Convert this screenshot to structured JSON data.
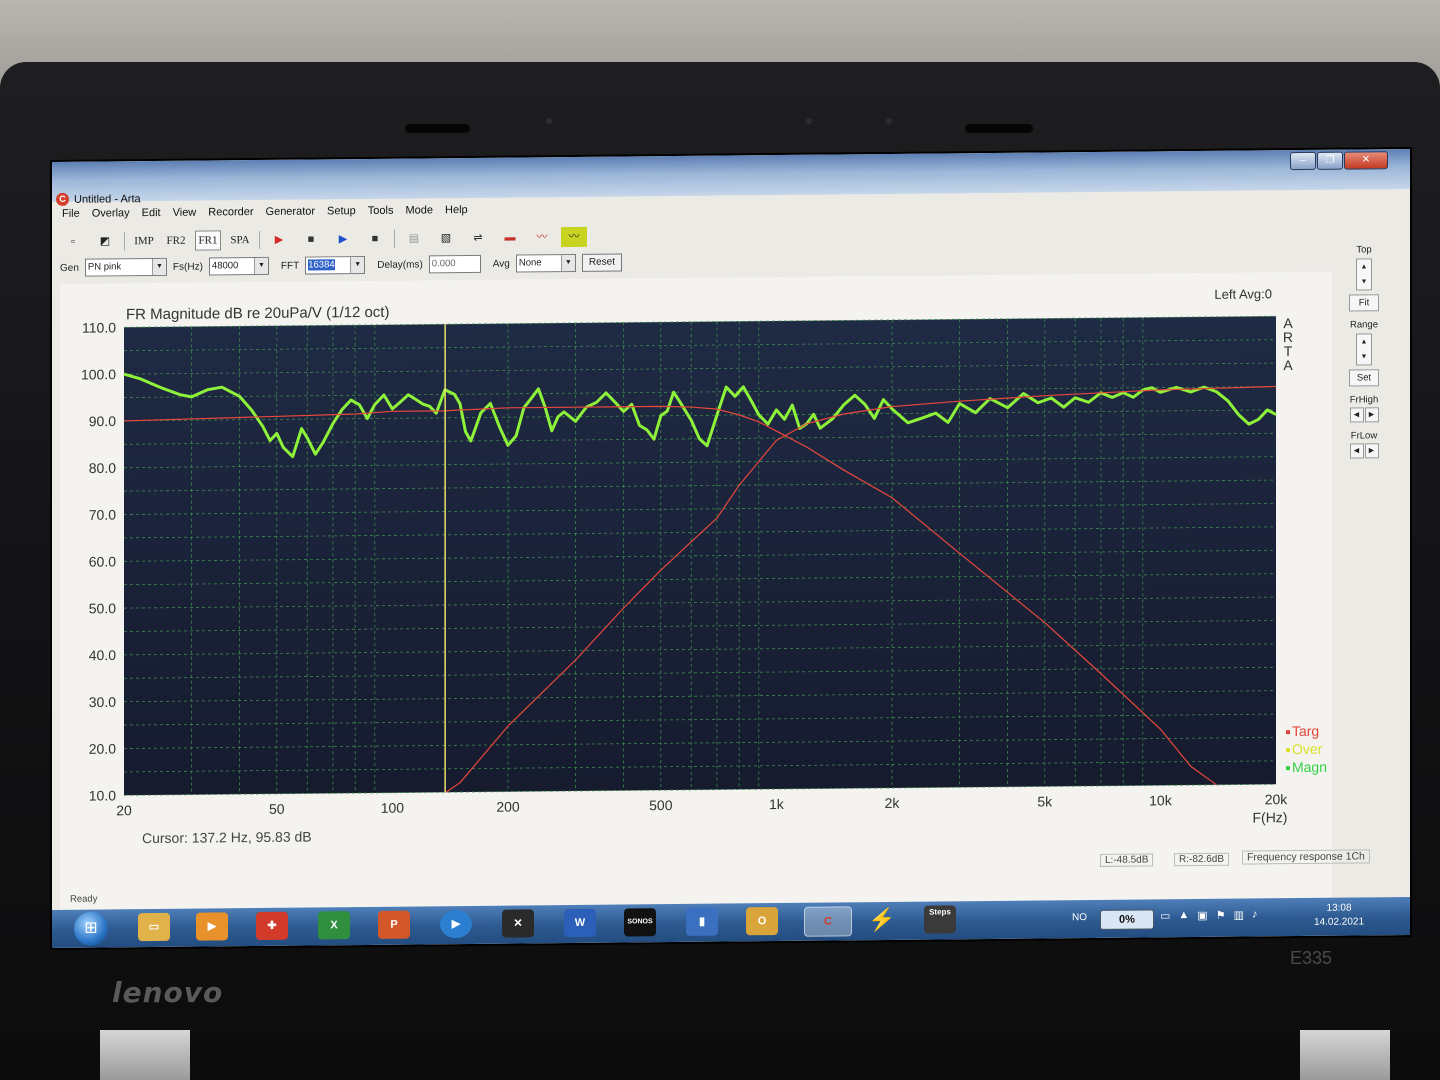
{
  "window": {
    "title": "Untitled - Arta"
  },
  "menu": [
    "File",
    "Overlay",
    "Edit",
    "View",
    "Recorder",
    "Generator",
    "Setup",
    "Tools",
    "Mode",
    "Help"
  ],
  "toolbar": {
    "modes": [
      "IMP",
      "FR2",
      "FR1",
      "SPA"
    ],
    "active_mode": "FR1"
  },
  "controls": {
    "gen_label": "Gen",
    "gen_value": "PN pink",
    "fs_label": "Fs(Hz)",
    "fs_value": "48000",
    "fft_label": "FFT",
    "fft_value": "16384",
    "delay_label": "Delay(ms)",
    "delay_value": "0.000",
    "avg_label": "Avg",
    "avg_value": "None",
    "reset_label": "Reset"
  },
  "right_panel": {
    "top_label": "Top",
    "fit_label": "Fit",
    "range_label": "Range",
    "set_label": "Set",
    "frhigh_label": "FrHigh",
    "frlow_label": "FrLow"
  },
  "status": {
    "ready": "Ready",
    "left_level": "L:-48.5dB",
    "right_level": "R:-82.6dB",
    "mode": "Frequency response 1Ch"
  },
  "taskbar": {
    "language": "NO",
    "cpu": "0%",
    "time": "13:08",
    "date": "14.02.2021",
    "apps": [
      "explorer-icon",
      "media-icon",
      "app-red-icon",
      "excel-icon",
      "powerpoint-icon",
      "player-icon",
      "arta-alt-icon",
      "word-icon",
      "sonos-icon",
      "app-blue-icon",
      "outlook-icon",
      "arta-icon",
      "bolt-icon",
      "steps-icon"
    ],
    "sonos_label": "SONOS",
    "steps_label": "Steps"
  },
  "laptop": {
    "brand": "lenovo",
    "model": "E335"
  },
  "chart_data": {
    "type": "line",
    "title": "FR Magnitude dB re 20uPa/V (1/12 oct)",
    "top_right_label": "Left  Avg:0",
    "side_label": "ARTA",
    "xlabel": "F(Hz)",
    "x_scale": "log",
    "xlim": [
      20,
      20000
    ],
    "ylim": [
      10,
      110
    ],
    "y_ticks": [
      "110.0",
      "100.0",
      "90.0",
      "80.0",
      "70.0",
      "60.0",
      "50.0",
      "40.0",
      "30.0",
      "20.0",
      "10.0"
    ],
    "x_ticks": [
      {
        "v": 20,
        "label": "20"
      },
      {
        "v": 50,
        "label": "50"
      },
      {
        "v": 100,
        "label": "100"
      },
      {
        "v": 200,
        "label": "200"
      },
      {
        "v": 500,
        "label": "500"
      },
      {
        "v": 1000,
        "label": "1k"
      },
      {
        "v": 2000,
        "label": "2k"
      },
      {
        "v": 5000,
        "label": "5k"
      },
      {
        "v": 10000,
        "label": "10k"
      },
      {
        "v": 20000,
        "label": "20k"
      }
    ],
    "cursor": {
      "x": 137.2,
      "y": 95.83,
      "text": "Cursor:  137.2 Hz, 95.83 dB"
    },
    "legend": [
      {
        "name": "Targ",
        "color": "#e0453a"
      },
      {
        "name": "Over",
        "color": "#d8e02a"
      },
      {
        "name": "Magn",
        "color": "#34d14a"
      }
    ],
    "series": [
      {
        "name": "Magn",
        "color": "#8ef23a",
        "x": [
          20,
          22,
          25,
          28,
          30,
          33,
          36,
          40,
          43,
          46,
          48,
          50,
          52,
          55,
          58,
          60,
          63,
          66,
          70,
          74,
          78,
          82,
          86,
          90,
          95,
          100,
          105,
          110,
          115,
          120,
          125,
          130,
          137,
          145,
          150,
          155,
          160,
          165,
          170,
          180,
          190,
          200,
          210,
          220,
          230,
          240,
          250,
          260,
          270,
          280,
          300,
          320,
          340,
          360,
          380,
          400,
          420,
          440,
          460,
          480,
          500,
          520,
          540,
          560,
          600,
          630,
          660,
          700,
          740,
          780,
          820,
          860,
          900,
          950,
          1000,
          1050,
          1100,
          1150,
          1200,
          1250,
          1300,
          1400,
          1500,
          1600,
          1700,
          1800,
          1900,
          2000,
          2200,
          2400,
          2600,
          2800,
          3000,
          3300,
          3600,
          4000,
          4400,
          4800,
          5200,
          5600,
          6000,
          6500,
          7000,
          7500,
          8000,
          8500,
          9000,
          9500,
          10000,
          11000,
          12000,
          13000,
          14000,
          15000,
          16000,
          17000,
          18000,
          19000,
          20000
        ],
        "y": [
          100,
          99,
          97,
          95.5,
          95,
          96.5,
          97,
          95,
          92,
          88.5,
          85.5,
          87,
          84,
          82,
          88,
          86,
          82.5,
          85,
          89,
          92,
          94,
          93,
          90,
          93,
          95,
          92,
          93.5,
          95,
          94,
          93,
          92.5,
          91,
          96,
          95,
          93,
          87,
          85,
          88,
          91,
          93,
          88,
          84,
          86,
          92,
          94,
          96,
          92,
          87,
          90,
          91,
          89,
          92,
          93,
          95,
          93,
          91,
          92.5,
          88,
          87,
          85,
          90,
          91,
          95,
          93,
          89,
          85,
          83.5,
          90,
          96,
          94,
          96,
          93,
          90,
          88,
          91,
          89,
          92,
          87,
          88,
          90,
          87,
          89,
          92,
          94,
          92,
          89,
          93,
          91,
          88,
          89,
          90,
          88,
          92,
          90,
          93,
          91,
          94,
          92,
          93,
          91,
          93,
          92,
          94,
          93,
          94,
          93,
          94.5,
          95,
          94,
          95,
          94,
          95,
          94,
          92,
          89,
          87,
          88,
          90,
          89
        ]
      },
      {
        "name": "Targ-low",
        "color": "#e8483c",
        "x": [
          20,
          40,
          80,
          100,
          135,
          200,
          300,
          400,
          500,
          600,
          700,
          800,
          900,
          1000,
          1200,
          1500,
          2000,
          3000,
          5000,
          7000,
          10000,
          12000,
          14000
        ],
        "y": [
          90,
          90.5,
          91,
          91.5,
          91.5,
          92,
          92,
          92,
          92,
          91.8,
          91.3,
          90,
          88.5,
          86.5,
          83,
          78,
          72,
          60,
          45,
          34,
          22,
          14,
          10
        ]
      },
      {
        "name": "Targ-high",
        "color": "#e8483c",
        "x": [
          138,
          150,
          200,
          300,
          400,
          500,
          600,
          700,
          800,
          900,
          1000,
          1200,
          1500,
          2000,
          3000,
          5000,
          10000,
          20000
        ],
        "y": [
          10,
          12,
          24,
          38,
          49,
          57,
          63,
          68,
          75,
          80,
          84.5,
          88,
          90,
          91.5,
          92.5,
          93.5,
          94.5,
          95
        ]
      }
    ]
  }
}
